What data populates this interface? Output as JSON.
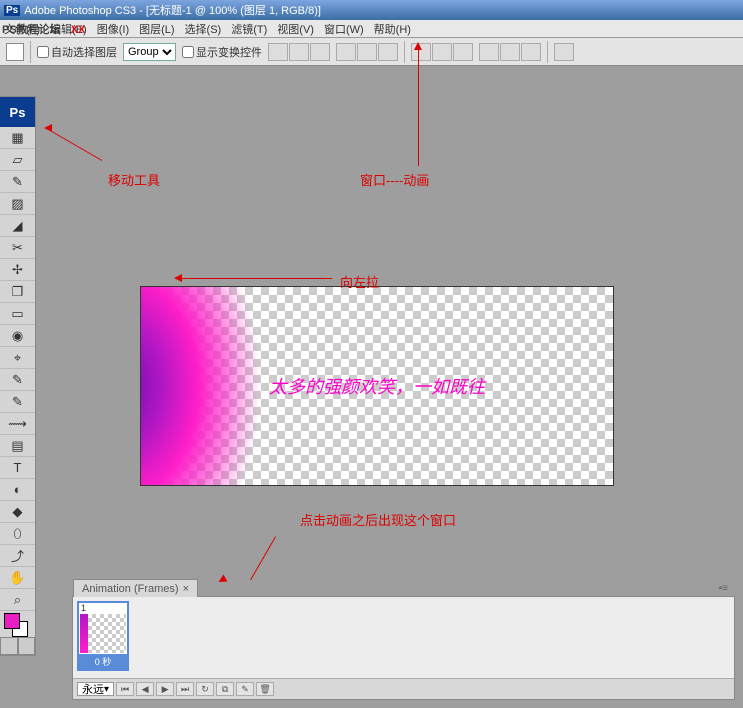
{
  "title": "Adobe Photoshop CS3 - [无标题-1 @ 100% (图层 1, RGB/8)]",
  "watermark": {
    "text": "PS教程论坛",
    "suffix": "XX"
  },
  "menu": [
    "文件(F)",
    "编辑(E)",
    "图像(I)",
    "图层(L)",
    "选择(S)",
    "滤镜(T)",
    "视图(V)",
    "窗口(W)",
    "帮助(H)"
  ],
  "options": {
    "auto_select": "自动选择图层",
    "group": "Group",
    "transform": "显示变换控件"
  },
  "tools": [
    "▦",
    "▱",
    "✎",
    "▨",
    "◢",
    "✂",
    "✢",
    "❐",
    "▭",
    "◉",
    "⌖",
    "✎",
    "✎",
    "⟿",
    "▤",
    "▭",
    "◐",
    "◆",
    "⬯",
    "⤴",
    "T",
    "↖",
    "⬚",
    "✋",
    "⌕"
  ],
  "canvas": {
    "text": "太多的强颜欢笑，一如既往"
  },
  "annotations": {
    "move_tool": "移动工具",
    "window_anim": "窗口----动画",
    "drag_left": "向左拉",
    "click_anim": "点击动画之后出现这个窗口"
  },
  "animation": {
    "tab": "Animation (Frames)",
    "frame_num": "1",
    "frame_dur": "0 秒",
    "loop": "永远",
    "controls": [
      "⏮",
      "◀",
      "▶",
      "⏭",
      "↻",
      "⧉",
      "✎",
      "🗑"
    ]
  }
}
